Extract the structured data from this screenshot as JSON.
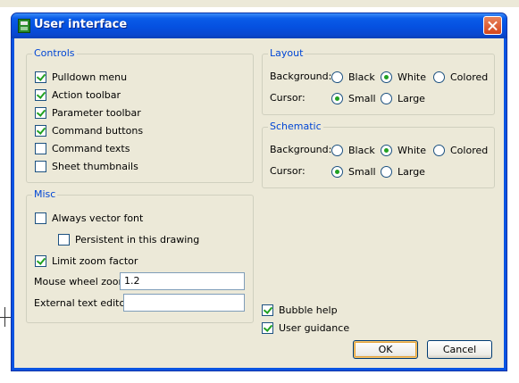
{
  "window": {
    "title": "User interface"
  },
  "controls": {
    "title": "Controls",
    "items": [
      {
        "label": "Pulldown menu",
        "checked": true
      },
      {
        "label": "Action toolbar",
        "checked": true
      },
      {
        "label": "Parameter toolbar",
        "checked": true
      },
      {
        "label": "Command buttons",
        "checked": true
      },
      {
        "label": "Command texts",
        "checked": false
      },
      {
        "label": "Sheet thumbnails",
        "checked": false
      }
    ]
  },
  "misc": {
    "title": "Misc",
    "always_vector_font": {
      "label": "Always vector font",
      "checked": false
    },
    "persistent": {
      "label": "Persistent in this drawing",
      "checked": false
    },
    "limit_zoom": {
      "label": "Limit zoom factor",
      "checked": true
    },
    "mouse_wheel_label": "Mouse wheel zoom",
    "mouse_wheel_value": "1.2",
    "external_editor_label": "External text editor",
    "external_editor_value": ""
  },
  "layout": {
    "title": "Layout",
    "background_label": "Background:",
    "background_options": [
      "Black",
      "White",
      "Colored"
    ],
    "background_selected": "White",
    "cursor_label": "Cursor:",
    "cursor_options": [
      "Small",
      "Large"
    ],
    "cursor_selected": "Small"
  },
  "schematic": {
    "title": "Schematic",
    "background_label": "Background:",
    "background_options": [
      "Black",
      "White",
      "Colored"
    ],
    "background_selected": "White",
    "cursor_label": "Cursor:",
    "cursor_options": [
      "Small",
      "Large"
    ],
    "cursor_selected": "Small"
  },
  "bubble_help": {
    "label": "Bubble help",
    "checked": true
  },
  "user_guidance": {
    "label": "User guidance",
    "checked": true
  },
  "buttons": {
    "ok": "OK",
    "cancel": "Cancel"
  },
  "colors": {
    "titlebar": "#0a54e2",
    "dialog_bg": "#ece9d8",
    "group_title": "#0046d5",
    "check": "#21a121",
    "close_button": "#d4461c"
  }
}
